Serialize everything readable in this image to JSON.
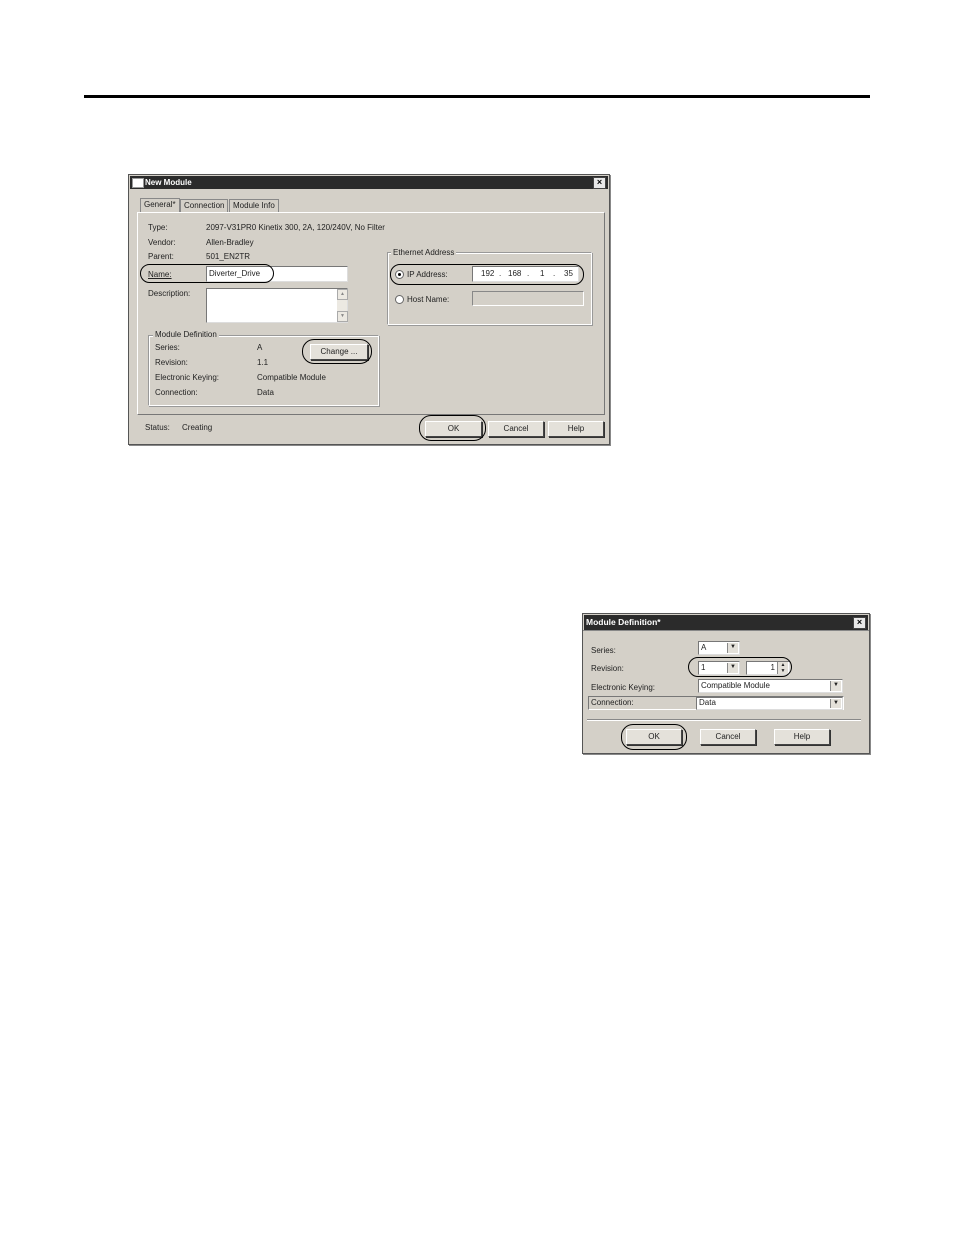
{
  "new_module": {
    "title": "New Module",
    "tabs": [
      "General*",
      "Connection",
      "Module Info"
    ],
    "type_label": "Type:",
    "type_value": "2097-V31PR0 Kinetix 300, 2A, 120/240V, No Filter",
    "vendor_label": "Vendor:",
    "vendor_value": "Allen-Bradley",
    "parent_label": "Parent:",
    "parent_value": "501_EN2TR",
    "name_label": "Name:",
    "name_value": "Diverter_Drive",
    "description_label": "Description:",
    "description_value": "",
    "module_definition": {
      "title": "Module Definition",
      "series_label": "Series:",
      "series_value": "A",
      "revision_label": "Revision:",
      "revision_value": "1.1",
      "keying_label": "Electronic Keying:",
      "keying_value": "Compatible Module",
      "connection_label": "Connection:",
      "connection_value": "Data",
      "change_button": "Change ..."
    },
    "ethernet": {
      "title": "Ethernet Address",
      "ip_label": "IP Address:",
      "ip_octets": [
        "192",
        "168",
        "1",
        "35"
      ],
      "host_label": "Host Name:",
      "host_value": ""
    },
    "status_label": "Status:",
    "status_value": "Creating",
    "ok_button": "OK",
    "cancel_button": "Cancel",
    "help_button": "Help"
  },
  "module_definition_dialog": {
    "title": "Module Definition*",
    "series_label": "Series:",
    "series_value": "A",
    "revision_label": "Revision:",
    "revision_major": "1",
    "revision_minor": "1",
    "keying_label": "Electronic Keying:",
    "keying_value": "Compatible Module",
    "connection_label": "Connection:",
    "connection_value": "Data",
    "ok_button": "OK",
    "cancel_button": "Cancel",
    "help_button": "Help"
  }
}
